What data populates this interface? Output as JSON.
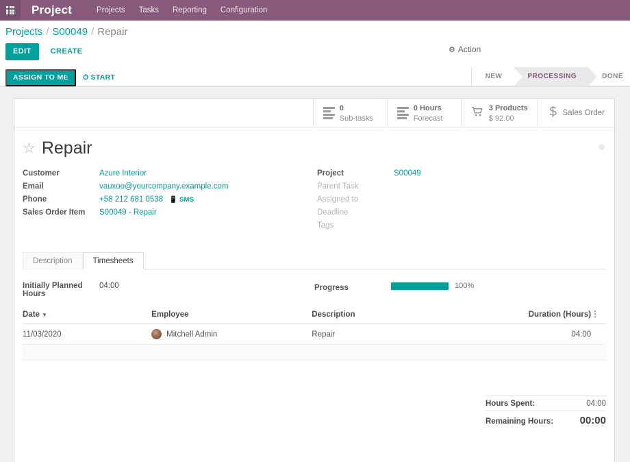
{
  "navbar": {
    "apps_icon": "apps-grid-icon",
    "brand": "Project",
    "menus": [
      "Projects",
      "Tasks",
      "Reporting",
      "Configuration"
    ]
  },
  "breadcrumb": {
    "root": "Projects",
    "sep": "/",
    "parent": "S00049",
    "current": "Repair"
  },
  "controls": {
    "edit_label": "EDIT",
    "create_label": "CREATE",
    "action_label": "Action",
    "action_icon": "gear-icon"
  },
  "record_actions": {
    "assign_label": "ASSIGN TO ME",
    "start_label": "START",
    "start_icon": "clock-icon"
  },
  "statusbar": {
    "stages": [
      {
        "label": "NEW",
        "active": false
      },
      {
        "label": "PROCESSING",
        "active": true
      },
      {
        "label": "DONE",
        "active": false
      }
    ]
  },
  "stat_buttons": [
    {
      "icon": "list-icon",
      "value": "0",
      "label": "Sub-tasks"
    },
    {
      "icon": "list-icon",
      "value": "0 Hours",
      "label": "Forecast"
    },
    {
      "icon": "cart-icon",
      "value": "3 Products",
      "label": "$ 92.00"
    },
    {
      "icon": "dollar-icon",
      "single": "Sales Order"
    }
  ],
  "title": {
    "star_icon": "star-outline-icon",
    "text": "Repair",
    "kanban_dot": "color-dot"
  },
  "fields_left": [
    {
      "label": "Customer",
      "value": "Azure Interior",
      "link": true
    },
    {
      "label": "Email",
      "value": "vauxoo@yourcompany.example.com",
      "link": true
    },
    {
      "label": "Phone",
      "value": "+58 212 681 0538",
      "link": true,
      "sms": "SMS",
      "sms_icon": "mobile-icon"
    },
    {
      "label": "Sales Order Item",
      "value": "S00049 - Repair",
      "link": true
    }
  ],
  "fields_right": [
    {
      "label": "Project",
      "value": "S00049",
      "link": true,
      "empty": false
    },
    {
      "label": "Parent Task",
      "value": "",
      "empty": true
    },
    {
      "label": "Assigned to",
      "value": "",
      "empty": true
    },
    {
      "label": "Deadline",
      "value": "",
      "empty": true
    },
    {
      "label": "Tags",
      "value": "",
      "empty": true
    }
  ],
  "notebook": {
    "tabs": [
      {
        "label": "Description",
        "active": false
      },
      {
        "label": "Timesheets",
        "active": true
      }
    ]
  },
  "timesheets": {
    "planned_label": "Initially Planned Hours",
    "planned_value": "04:00",
    "progress_label": "Progress",
    "progress_percent": 100,
    "progress_text": "100%",
    "progress_color": "#00A09D",
    "columns": [
      "Date",
      "Employee",
      "Description",
      "Duration (Hours)"
    ],
    "sort_column": "Date",
    "sort_caret": "▼",
    "optional_icon": "vertical-dots-icon",
    "rows": [
      {
        "date": "11/03/2020",
        "employee": "Mitchell Admin",
        "avatar": "user-avatar",
        "description": "Repair",
        "duration": "04:00"
      }
    ],
    "totals": [
      {
        "label": "Hours Spent:",
        "value": "04:00",
        "emphasis": false
      },
      {
        "label": "Remaining Hours:",
        "value": "00:00",
        "emphasis": true
      }
    ]
  },
  "colors": {
    "brand_purple": "#875A7B",
    "accent_teal": "#00A09D",
    "stage_active_bg": "#e9e9e9"
  }
}
